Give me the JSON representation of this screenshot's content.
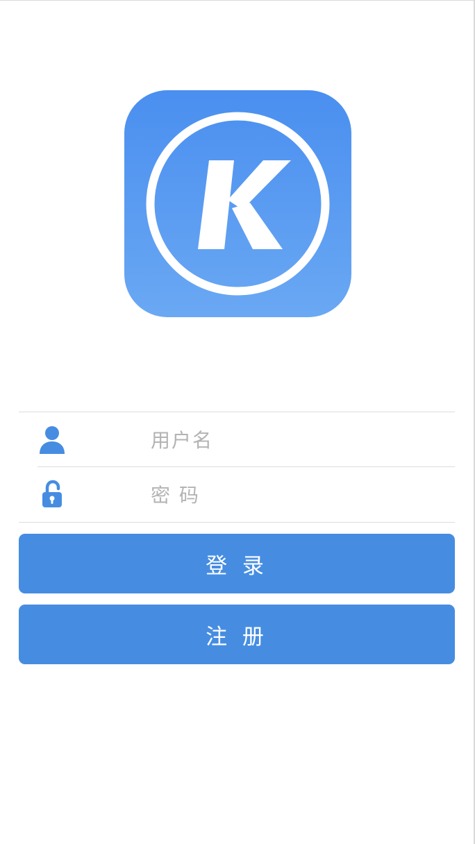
{
  "login_form": {
    "username": {
      "icon": "user-icon",
      "value": "",
      "placeholder": "用户名"
    },
    "password": {
      "icon": "unlock-icon",
      "value": "",
      "placeholder": "密 码"
    }
  },
  "buttons": {
    "login_label": "登 录",
    "register_label": "注 册"
  },
  "colors": {
    "accent": "#468de2",
    "logo_top": "#4a90e8",
    "logo_bottom": "#6aa8f3",
    "divider": "#dcdcdc",
    "placeholder": "#b3b3b3"
  },
  "logo": {
    "icon": "kugou-k-logo"
  }
}
